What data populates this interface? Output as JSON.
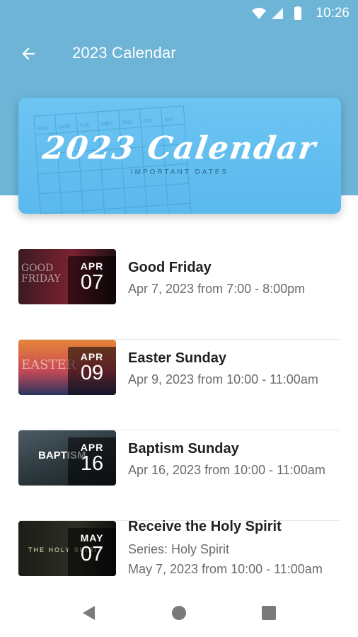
{
  "status_bar": {
    "time": "10:26"
  },
  "app_bar": {
    "title": "2023 Calendar"
  },
  "banner": {
    "title": "2023 Calendar",
    "subtitle": "IMPORTANT DATES",
    "weekdays": [
      "SUN",
      "MON",
      "TUE",
      "WED",
      "THU",
      "FRI",
      "SAT"
    ]
  },
  "events": [
    {
      "month": "APR",
      "day": "07",
      "title": "Good Friday",
      "lines": [
        "Apr 7, 2023 from 7:00 - 8:00pm"
      ],
      "thumb_text": "GOOD FRIDAY"
    },
    {
      "month": "APR",
      "day": "09",
      "title": "Easter Sunday",
      "lines": [
        "Apr 9, 2023 from 10:00 - 11:00am"
      ],
      "thumb_text": "EASTER"
    },
    {
      "month": "APR",
      "day": "16",
      "title": "Baptism Sunday",
      "lines": [
        "Apr 16, 2023 from 10:00 - 11:00am"
      ],
      "thumb_text": "BAPTISM"
    },
    {
      "month": "MAY",
      "day": "07",
      "title": "Receive the Holy Spirit",
      "lines": [
        "Series: Holy Spirit",
        "May 7, 2023 from 10:00 - 11:00am"
      ],
      "thumb_text": "THE HOLY SPIRIT"
    }
  ],
  "colors": {
    "header": "#6db4d7",
    "banner": "#6cc4f2"
  },
  "icons": [
    "wifi-icon",
    "signal-icon",
    "battery-icon",
    "back-arrow-icon",
    "nav-back-icon",
    "nav-home-icon",
    "nav-recents-icon"
  ]
}
